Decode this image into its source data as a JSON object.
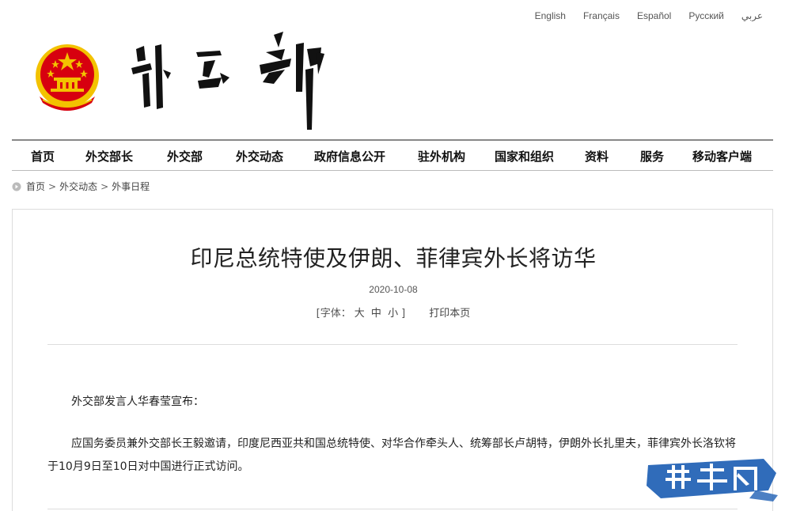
{
  "languages": [
    "English",
    "Français",
    "Español",
    "Русский",
    "عربي"
  ],
  "logo": {
    "calligraphy_text": "外交部"
  },
  "nav": {
    "items": [
      "首页",
      "外交部长",
      "外交部",
      "外交动态",
      "政府信息公开",
      "驻外机构",
      "国家和组织",
      "资料",
      "服务",
      "移动客户端"
    ]
  },
  "breadcrumb": {
    "home": "首页",
    "sep": ">",
    "level2": "外交动态",
    "level3": "外事日程"
  },
  "article": {
    "title": "印尼总统特使及伊朗、菲律宾外长将访华",
    "date": "2020-10-08",
    "font_size_label": "[字体：",
    "font_large": "大",
    "font_medium": "中",
    "font_small": "小",
    "font_close": "]",
    "print": "打印本页",
    "paragraphs": [
      "外交部发言人华春莹宣布：",
      "应国务委员兼外交部长王毅邀请，印度尼西亚共和国总统特使、对华合作牵头人、统筹部长卢胡特，伊朗外长扎里夫，菲律宾外长洛钦将于10月9日至10日对中国进行正式访问。"
    ]
  },
  "watermark": {
    "text": "菲华网"
  },
  "colors": {
    "emblem_red": "#d7000f",
    "emblem_gold": "#f3c200",
    "watermark_blue": "#1e5fb4"
  }
}
